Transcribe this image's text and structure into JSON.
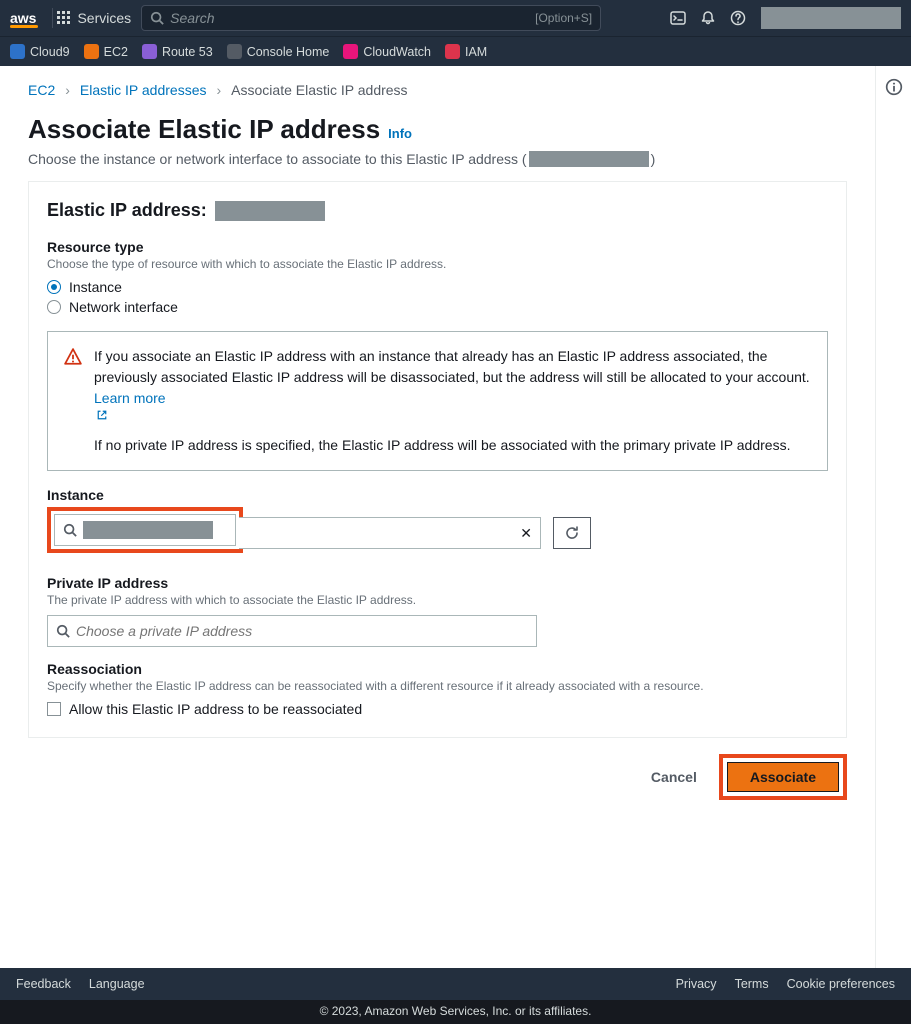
{
  "nav": {
    "logo": "aws",
    "services_label": "Services",
    "search_placeholder": "Search",
    "search_shortcut": "[Option+S]",
    "favorites": [
      {
        "name": "Cloud9",
        "iconClass": "fi-cloud9"
      },
      {
        "name": "EC2",
        "iconClass": "fi-ec2"
      },
      {
        "name": "Route 53",
        "iconClass": "fi-r53"
      },
      {
        "name": "Console Home",
        "iconClass": "fi-ch"
      },
      {
        "name": "CloudWatch",
        "iconClass": "fi-cw"
      },
      {
        "name": "IAM",
        "iconClass": "fi-iam"
      }
    ]
  },
  "breadcrumb": {
    "items": [
      "EC2",
      "Elastic IP addresses",
      "Associate Elastic IP address"
    ]
  },
  "page": {
    "title": "Associate Elastic IP address",
    "info_label": "Info",
    "subhead_prefix": "Choose the instance or network interface to associate to this Elastic IP address (",
    "subhead_suffix": ")",
    "card_title_prefix": "Elastic IP address:"
  },
  "resource_type": {
    "label": "Resource type",
    "help": "Choose the type of resource with which to associate the Elastic IP address.",
    "options": [
      "Instance",
      "Network interface"
    ],
    "selected": "Instance"
  },
  "alert": {
    "p1": "If you associate an Elastic IP address with an instance that already has an Elastic IP address associated, the previously associated Elastic IP address will be disassociated, but the address will still be allocated to your account. ",
    "learn_more": "Learn more",
    "p2": "If no private IP address is specified, the Elastic IP address will be associated with the primary private IP address."
  },
  "instance": {
    "label": "Instance"
  },
  "private_ip": {
    "label": "Private IP address",
    "help": "The private IP address with which to associate the Elastic IP address.",
    "placeholder": "Choose a private IP address"
  },
  "reassociation": {
    "label": "Reassociation",
    "help": "Specify whether the Elastic IP address can be reassociated with a different resource if it already associated with a resource.",
    "checkbox_label": "Allow this Elastic IP address to be reassociated"
  },
  "actions": {
    "cancel": "Cancel",
    "associate": "Associate"
  },
  "footer": {
    "left": [
      "Feedback",
      "Language"
    ],
    "right": [
      "Privacy",
      "Terms",
      "Cookie preferences"
    ],
    "copyright": "© 2023, Amazon Web Services, Inc. or its affiliates."
  }
}
